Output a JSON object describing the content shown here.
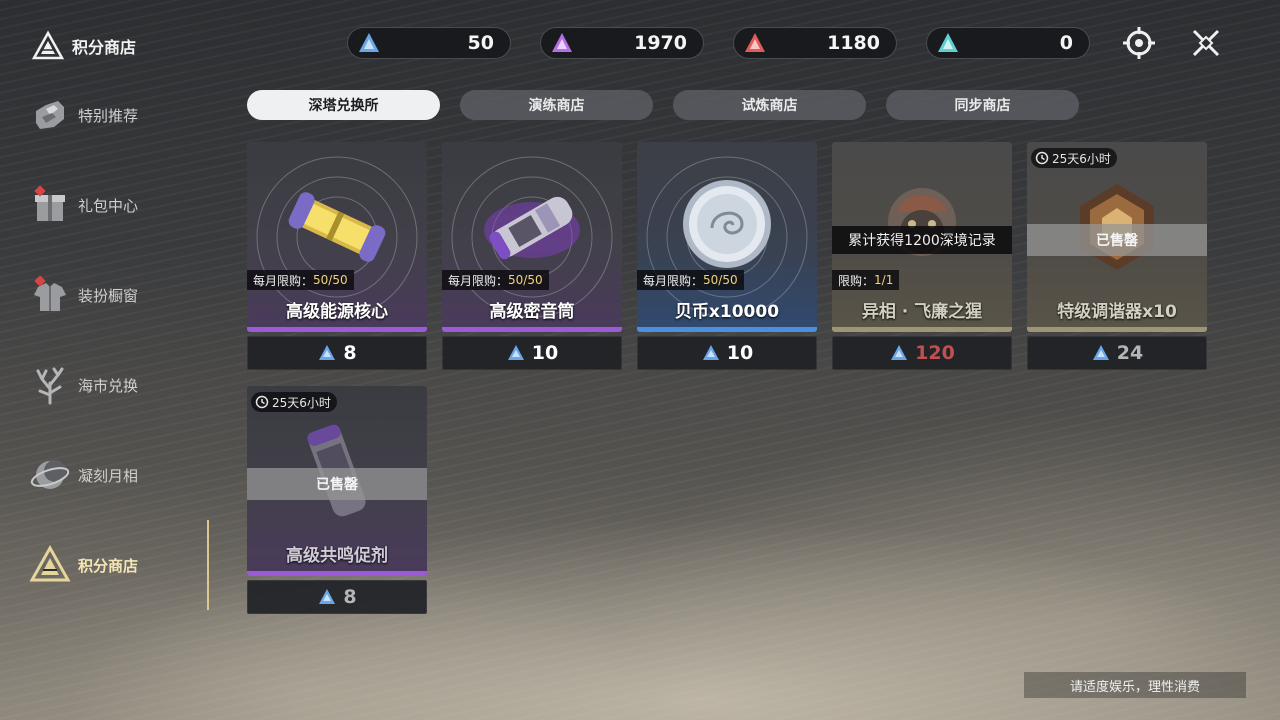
{
  "header": {
    "title": "积分商店"
  },
  "sidebar": {
    "items": [
      {
        "label": "特别推荐",
        "icon": "recommend-icon"
      },
      {
        "label": "礼包中心",
        "icon": "gift-icon"
      },
      {
        "label": "装扮橱窗",
        "icon": "outfit-icon"
      },
      {
        "label": "海市兑换",
        "icon": "coral-icon"
      },
      {
        "label": "凝刻月相",
        "icon": "moon-icon"
      },
      {
        "label": "积分商店",
        "icon": "points-shop-icon",
        "active": true
      }
    ]
  },
  "currencies": [
    {
      "amount": "50",
      "color": "#6aa7e8"
    },
    {
      "amount": "1970",
      "color": "#b46ee6"
    },
    {
      "amount": "1180",
      "color": "#e25a5a"
    },
    {
      "amount": "0",
      "color": "#5fcfd0"
    }
  ],
  "tabs": [
    {
      "label": "深塔兑换所",
      "active": true
    },
    {
      "label": "演练商店"
    },
    {
      "label": "试炼商店"
    },
    {
      "label": "同步商店"
    }
  ],
  "items": [
    {
      "name": "高级能源核心",
      "limit_label": "每月限购：",
      "limit_count": "50/50",
      "price": "8"
    },
    {
      "name": "高级密音筒",
      "limit_label": "每月限购：",
      "limit_count": "50/50",
      "price": "10"
    },
    {
      "name": "贝币x10000",
      "limit_label": "每月限购：",
      "limit_count": "50/50",
      "price": "10"
    },
    {
      "name": "异相 · 飞廉之猩",
      "requirement": "累计获得1200深境记录",
      "limit_label": "限购：",
      "limit_count": "1/1",
      "price": "120"
    },
    {
      "name": "特级调谐器x10",
      "timer": "25天6小时",
      "status": "已售罄",
      "price": "24"
    },
    {
      "name": "高级共鸣促剂",
      "timer": "25天6小时",
      "status": "已售罄",
      "price": "8"
    }
  ],
  "footer": {
    "note": "请适度娱乐，理性消费"
  },
  "colors": {
    "accent_gold": "#d9c98f",
    "purple_bar": "#9b5bd8",
    "blue_bar": "#4a8fe0",
    "price_red": "#c2504f"
  }
}
